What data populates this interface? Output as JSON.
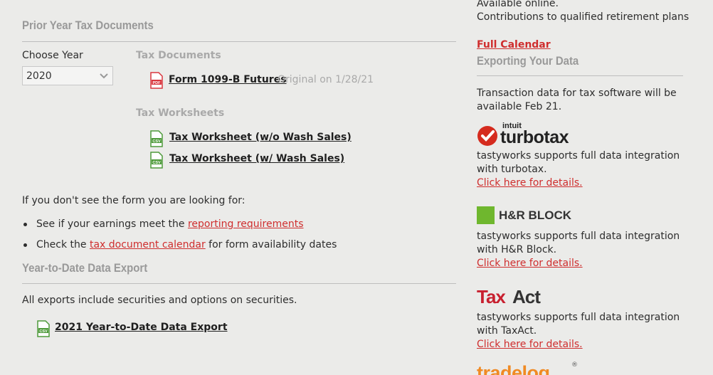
{
  "prior_year": {
    "title": "Prior Year Tax Documents",
    "choose_year_label": "Choose Year",
    "year_select_value": "2020",
    "tax_documents_label": "Tax Documents",
    "form_1099": {
      "label": "Form 1099-B Futures",
      "status": "Original on 1/28/21",
      "badge": "PDF"
    },
    "tax_worksheets_label": "Tax Worksheets",
    "worksheets": [
      {
        "label": "Tax Worksheet (w/o Wash Sales)",
        "badge": "CSV"
      },
      {
        "label": "Tax Worksheet (w/ Wash Sales)",
        "badge": "CSV"
      }
    ],
    "not_found_text": "If you don't see the form you are looking for:",
    "bullet1": {
      "prefix": "See if your earnings meet the ",
      "link": "reporting requirements"
    },
    "bullet2": {
      "prefix": "Check the ",
      "link": "tax document calendar",
      "suffix": " for form availability dates"
    }
  },
  "ytd": {
    "title": "Year-to-Date Data Export",
    "description": "All exports include securities and options on securities.",
    "export_link": "2021 Year-to-Date Data Export",
    "badge": "CSV"
  },
  "right": {
    "calendar_line1": "Available online.",
    "calendar_line2": "Contributions to qualified retirement plans",
    "full_calendar_link": "Full Calendar",
    "exporting_title": "Exporting Your Data",
    "transaction_line1": "Transaction data for tax software will be",
    "transaction_line2": "available Feb 21.",
    "turbotax": {
      "logo_small": "intuit",
      "logo_main": "turbotax",
      "line1": "tastyworks supports full data integration",
      "line2": "with turbotax.",
      "link": "Click here for details."
    },
    "hrblock": {
      "logo": "H&R BLOCK",
      "line1": "tastyworks supports full data integration",
      "line2": "with H&R Block.",
      "link": "Click here for details."
    },
    "taxact": {
      "logo_a": "Tax",
      "logo_b": "Act",
      "line1": "tastyworks supports full data integration",
      "line2": "with TaxAct.",
      "link": "Click here for details."
    },
    "tradelog": {
      "logo": "tradelog"
    }
  },
  "colors": {
    "background": "#ebebe9",
    "link_red": "#cf2e2e",
    "pdf_red": "#d9363e",
    "csv_green": "#4e9a3a",
    "hrblock_green": "#6fb72e",
    "turbotax_red": "#d52b1e",
    "tradelog_orange": "#f08a24"
  }
}
